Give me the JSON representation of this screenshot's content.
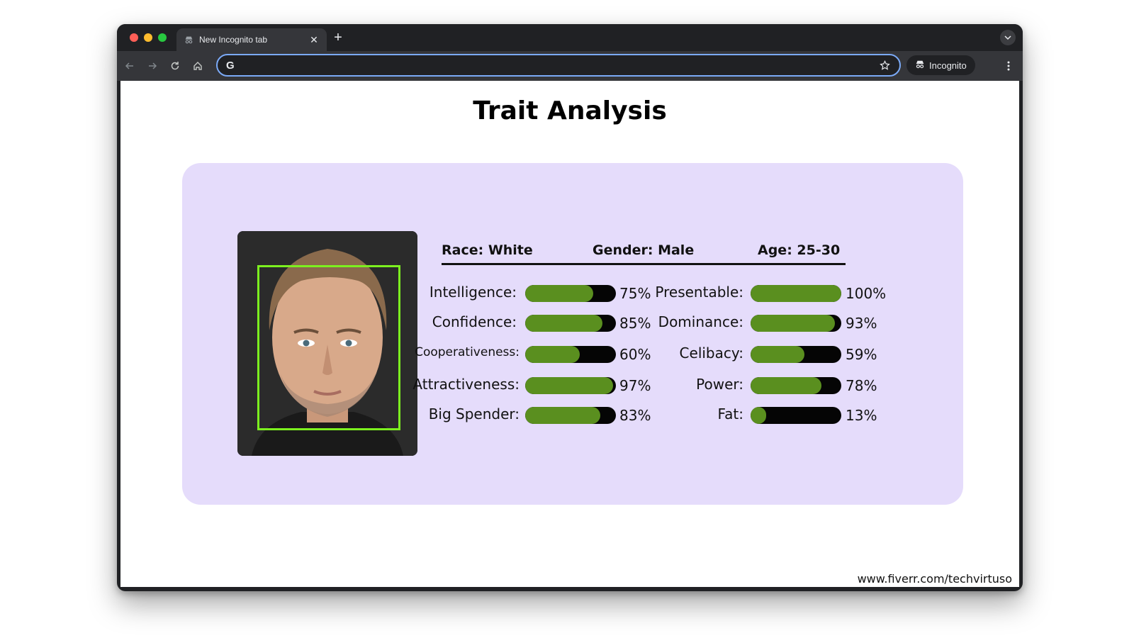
{
  "browser": {
    "tab_title": "New Incognito tab",
    "address_value": "",
    "incognito_label": "Incognito"
  },
  "page": {
    "title": "Trait Analysis",
    "footer": "www.fiverr.com/techvirtuso"
  },
  "info": {
    "race": "Race: White",
    "gender": "Gender: Male",
    "age": "Age: 25-30"
  },
  "traits_left": [
    {
      "label": "Intelligence:",
      "percent_text": "75%",
      "value": 0.75
    },
    {
      "label": "Confidence:",
      "percent_text": "85%",
      "value": 0.85
    },
    {
      "label": "Cooperativeness:",
      "percent_text": "60%",
      "value": 0.6
    },
    {
      "label": "Attractiveness:",
      "percent_text": "97%",
      "value": 0.97
    },
    {
      "label": "Big Spender:",
      "percent_text": "83%",
      "value": 0.83
    }
  ],
  "traits_right": [
    {
      "label": "Presentable:",
      "percent_text": "100%",
      "value": 1.0
    },
    {
      "label": "Dominance:",
      "percent_text": "93%",
      "value": 0.93
    },
    {
      "label": "Celibacy:",
      "percent_text": "59%",
      "value": 0.59
    },
    {
      "label": "Power:",
      "percent_text": "78%",
      "value": 0.78
    },
    {
      "label": "Fat:",
      "percent_text": "13%",
      "value": 0.13
    }
  ],
  "colors": {
    "panel": "#e5dcfb",
    "bar_fill": "#5a8f1f",
    "bar_track": "#050505",
    "face_box": "#7cf01f"
  }
}
